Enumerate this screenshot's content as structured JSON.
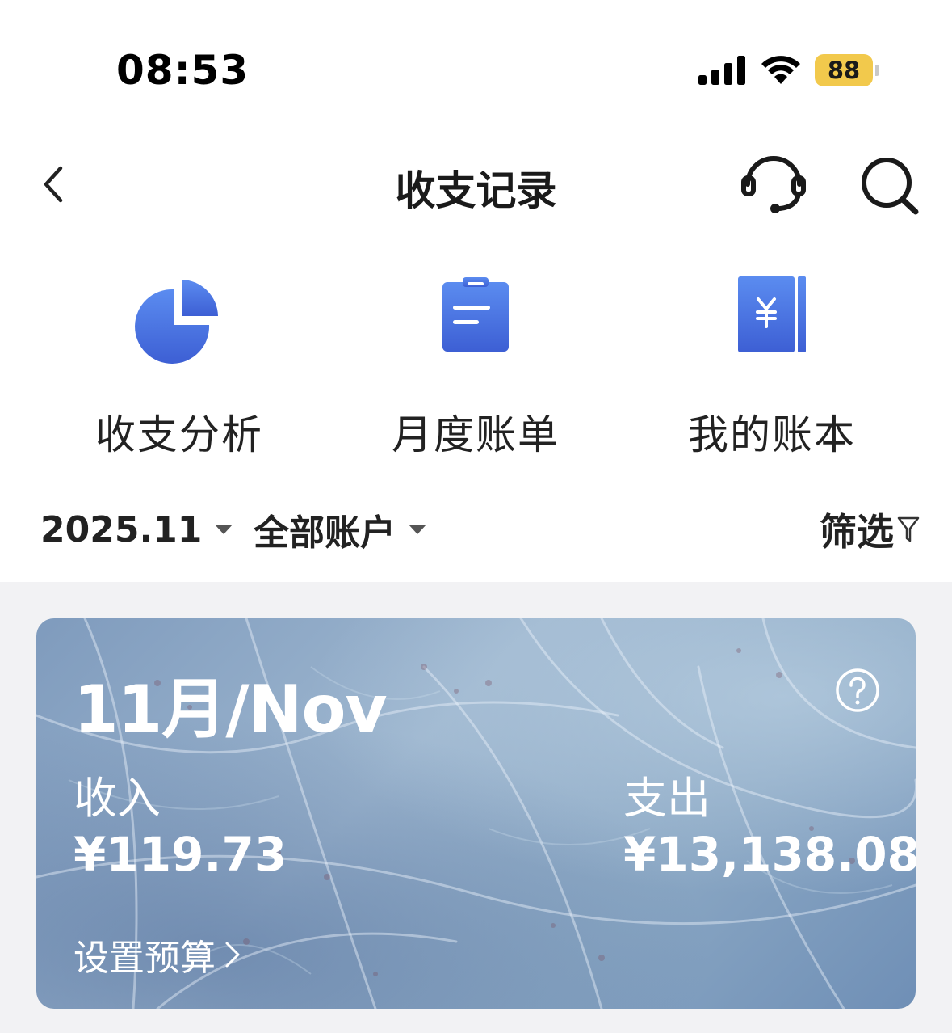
{
  "status_bar": {
    "time": "08:53",
    "battery": "88",
    "signal_icon": "cellular-signal-icon",
    "wifi_icon": "wifi-icon"
  },
  "nav": {
    "title": "收支记录",
    "back_icon": "chevron-left-icon",
    "service_icon": "headset-icon",
    "search_icon": "search-icon"
  },
  "shortcuts": [
    {
      "label": "收支分析",
      "icon": "pie-chart-icon"
    },
    {
      "label": "月度账单",
      "icon": "clipboard-icon"
    },
    {
      "label": "我的账本",
      "icon": "ledger-book-icon"
    }
  ],
  "filters": {
    "month": "2025.11",
    "account": "全部账户",
    "filter_label": "筛选"
  },
  "summary_card": {
    "month_title": "11月/Nov",
    "income_label": "收入",
    "income_amount": "¥119.73",
    "expense_label": "支出",
    "expense_amount": "¥13,138.08",
    "budget_link": "设置预算"
  },
  "colors": {
    "icon_gradient_top": "#5b8cf0",
    "icon_gradient_bottom": "#3d5fd4",
    "card_base": "#8ca8c6",
    "battery": "#f2c94c"
  }
}
